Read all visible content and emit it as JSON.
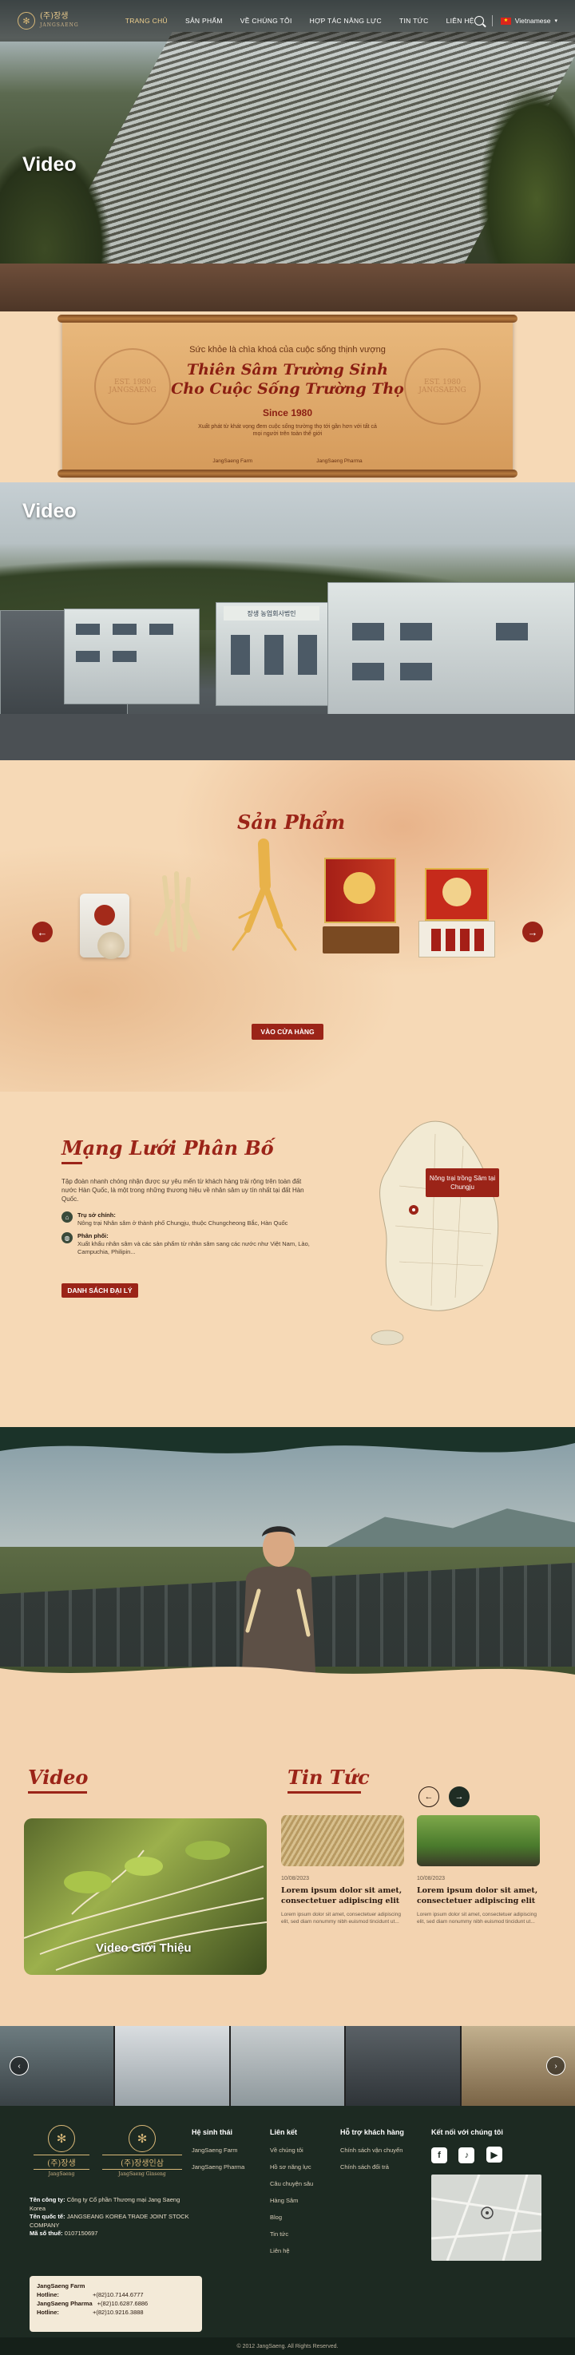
{
  "header": {
    "logo_title": "(주)장생",
    "logo_subtitle": "JANGSAENG",
    "nav": [
      {
        "label": "TRANG CHỦ",
        "active": true
      },
      {
        "label": "SẢN PHẨM",
        "active": false
      },
      {
        "label": "VỀ CHÚNG TÔI",
        "active": false
      },
      {
        "label": "HỢP TÁC NĂNG LỰC",
        "active": false
      },
      {
        "label": "TIN TỨC",
        "active": false
      },
      {
        "label": "LIÊN HỆ",
        "active": false
      }
    ],
    "language": "Vietnamese"
  },
  "hero_video_1": {
    "title": "Video"
  },
  "scroll_banner": {
    "subtitle": "Sức khỏe là chìa khoá của cuộc sống thịnh vượng",
    "heading_line1": "Thiên Sâm Trường Sinh",
    "heading_line2": "Cho Cuộc Sống Trường Thọ",
    "since": "Since 1980",
    "description": "Xuất phát từ khát vọng đem cuộc sống trường thọ tới gần hơn với tất cả mọi người trên toàn thế giới",
    "brand_left": "JangSaeng Farm",
    "brand_right": "JangSaeng Pharma",
    "stamp_left": "EST. 1980 JANGSAENG",
    "stamp_right": "EST. 1980 JANGSAENG"
  },
  "hero_video_2": {
    "title": "Video",
    "sign_text": "장생 농업회사법인"
  },
  "products": {
    "title": "Sản Phẩm",
    "items": [
      "ginseng-pack",
      "dried-ginseng-roots",
      "fresh-ginseng-root",
      "ginseng-gift-box",
      "red-ginseng-set"
    ],
    "shop_button": "VÀO CỬA HÀNG"
  },
  "distribution": {
    "title": "Mạng Lưới Phân Bố",
    "description": "Tập đoàn nhanh chóng nhận được sự yêu mến từ khách hàng trải rộng trên toàn đất nước Hàn Quốc, là một trong những thương hiệu về nhân sâm uy tín nhất tại đất Hàn Quốc.",
    "items": [
      {
        "title": "Trụ sở chính:",
        "text": "Nông trại Nhân sâm ở thành phố Chungju, thuộc Chungcheong Bắc, Hàn Quốc"
      },
      {
        "title": "Phân phối:",
        "text": "Xuất khẩu nhân sâm và các sản phẩm từ nhân sâm sang các nước như Việt Nam, Lào, Campuchia, Philipin..."
      }
    ],
    "button": "DANH SÁCH ĐẠI LÝ",
    "map_tooltip": "Nông trại trồng Sâm tại Chungju"
  },
  "video_section": {
    "title": "Video",
    "card_label": "Video  Giới Thiệu"
  },
  "news_section": {
    "title": "Tin Tức",
    "items": [
      {
        "date": "10/08/2023",
        "headline": "Lorem ipsum dolor sit amet, consectetuer adipiscing elit",
        "excerpt": "Lorem ipsum dolor sit amet, consectetuer adipiscing elit, sed diam nonummy nibh euismod tincidunt ut..."
      },
      {
        "date": "10/08/2023",
        "headline": "Lorem ipsum dolor sit amet, consectetuer adipiscing elit",
        "excerpt": "Lorem ipsum dolor sit amet, consectetuer adipiscing elit, sed diam nonummy nibh euismod tincidunt ut..."
      }
    ]
  },
  "footer": {
    "logo1_title": "(주)장생",
    "logo1_sub": "JangSaeng",
    "logo2_title": "(주)장생인삼",
    "logo2_sub": "JangSaeng Ginseng",
    "company_label": "Tên công ty:",
    "company_value": "Công ty Cổ phần Thương mại Jang Saeng Korea",
    "intl_label": "Tên quốc tế:",
    "intl_value": "JANGSEANG KOREA TRADE JOINT STOCK COMPANY",
    "tax_label": "Mã số thuế:",
    "tax_value": "0107150697",
    "hotlines": [
      {
        "name": "JangSaeng Farm",
        "label": "Hotline:",
        "number": "+(82)10.7144.6777"
      },
      {
        "name": "JangSaeng Pharma",
        "label": "Hotline:",
        "number": "+(82)10.6287.6886"
      },
      {
        "name": "",
        "label": "Hotline:",
        "number": "+(82)10.9216.3888"
      }
    ],
    "col1": {
      "title": "Hệ sinh thái",
      "links": [
        "JangSaeng Farm",
        "JangSaeng Pharma"
      ]
    },
    "col2": {
      "title": "Liên kết",
      "links": [
        "Về chúng tôi",
        "Hồ sơ năng lực",
        "Câu chuyện sâu",
        "Hàng Sâm",
        "Blog",
        "Tin tức",
        "Liên hệ"
      ]
    },
    "col3": {
      "title": "Hỗ trợ khách hàng",
      "links": [
        "Chính sách vận chuyển",
        "Chính sách đổi trả"
      ]
    },
    "col4": {
      "title": "Kết nối với chúng tôi",
      "social": [
        "f",
        "♪",
        "▶"
      ]
    },
    "copyright": "© 2012 JangSaeng. All Rights Reserved."
  }
}
